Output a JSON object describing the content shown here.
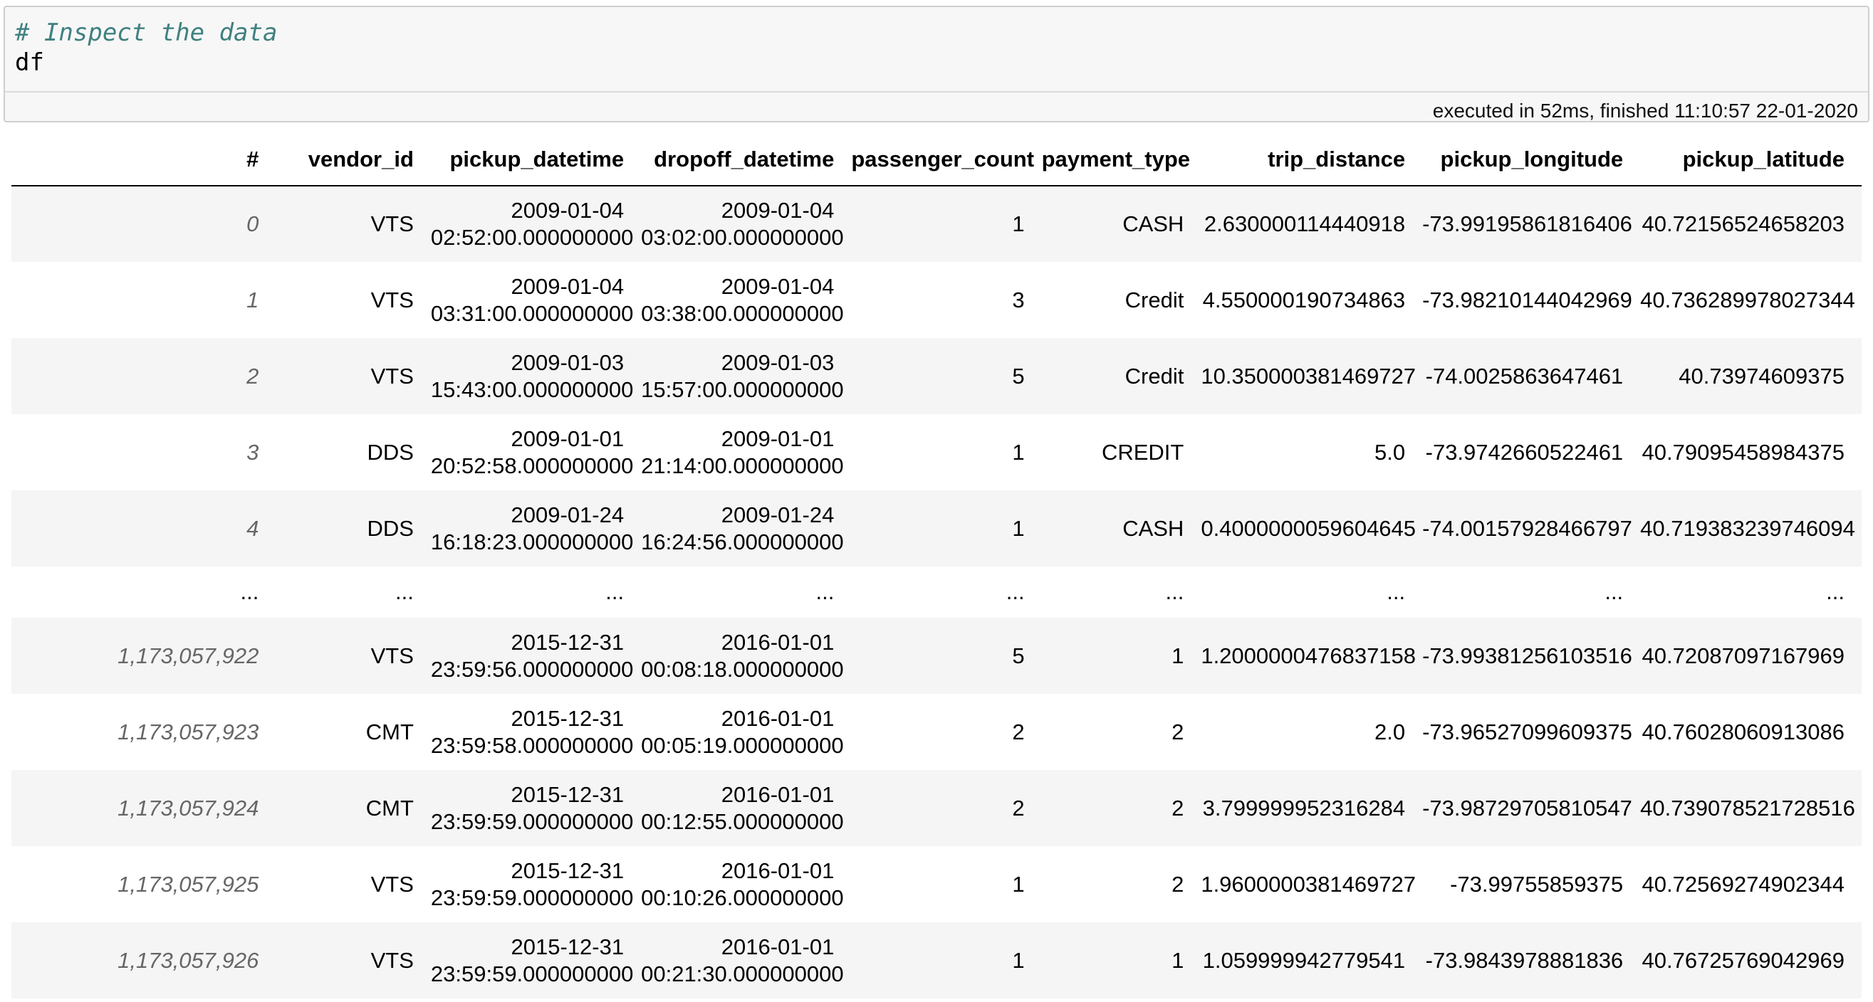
{
  "cell": {
    "comment": "# Inspect the data",
    "code": "df",
    "status": "executed in 52ms, finished 11:10:57 22-01-2020"
  },
  "table": {
    "columns": [
      "#",
      "vendor_id",
      "pickup_datetime",
      "dropoff_datetime",
      "passenger_count",
      "payment_type",
      "trip_distance",
      "pickup_longitude",
      "pickup_latitude"
    ],
    "rows_top": [
      {
        "idx": "0",
        "vendor": "VTS",
        "pickup_date": "2009-01-04",
        "pickup_time": "02:52:00.000000000",
        "dropoff_date": "2009-01-04",
        "dropoff_time": "03:02:00.000000000",
        "passengers": "1",
        "payment": "CASH",
        "distance": "2.630000114440918",
        "longitude": "-73.99195861816406",
        "latitude": "40.72156524658203"
      },
      {
        "idx": "1",
        "vendor": "VTS",
        "pickup_date": "2009-01-04",
        "pickup_time": "03:31:00.000000000",
        "dropoff_date": "2009-01-04",
        "dropoff_time": "03:38:00.000000000",
        "passengers": "3",
        "payment": "Credit",
        "distance": "4.550000190734863",
        "longitude": "-73.98210144042969",
        "latitude": "40.736289978027344"
      },
      {
        "idx": "2",
        "vendor": "VTS",
        "pickup_date": "2009-01-03",
        "pickup_time": "15:43:00.000000000",
        "dropoff_date": "2009-01-03",
        "dropoff_time": "15:57:00.000000000",
        "passengers": "5",
        "payment": "Credit",
        "distance": "10.350000381469727",
        "longitude": "-74.0025863647461",
        "latitude": "40.73974609375"
      },
      {
        "idx": "3",
        "vendor": "DDS",
        "pickup_date": "2009-01-01",
        "pickup_time": "20:52:58.000000000",
        "dropoff_date": "2009-01-01",
        "dropoff_time": "21:14:00.000000000",
        "passengers": "1",
        "payment": "CREDIT",
        "distance": "5.0",
        "longitude": "-73.9742660522461",
        "latitude": "40.79095458984375"
      },
      {
        "idx": "4",
        "vendor": "DDS",
        "pickup_date": "2009-01-24",
        "pickup_time": "16:18:23.000000000",
        "dropoff_date": "2009-01-24",
        "dropoff_time": "16:24:56.000000000",
        "passengers": "1",
        "payment": "CASH",
        "distance": "0.4000000059604645",
        "longitude": "-74.00157928466797",
        "latitude": "40.719383239746094"
      }
    ],
    "ellipsis": "...",
    "rows_bottom": [
      {
        "idx": "1,173,057,922",
        "vendor": "VTS",
        "pickup_date": "2015-12-31",
        "pickup_time": "23:59:56.000000000",
        "dropoff_date": "2016-01-01",
        "dropoff_time": "00:08:18.000000000",
        "passengers": "5",
        "payment": "1",
        "distance": "1.2000000476837158",
        "longitude": "-73.99381256103516",
        "latitude": "40.72087097167969"
      },
      {
        "idx": "1,173,057,923",
        "vendor": "CMT",
        "pickup_date": "2015-12-31",
        "pickup_time": "23:59:58.000000000",
        "dropoff_date": "2016-01-01",
        "dropoff_time": "00:05:19.000000000",
        "passengers": "2",
        "payment": "2",
        "distance": "2.0",
        "longitude": "-73.96527099609375",
        "latitude": "40.76028060913086"
      },
      {
        "idx": "1,173,057,924",
        "vendor": "CMT",
        "pickup_date": "2015-12-31",
        "pickup_time": "23:59:59.000000000",
        "dropoff_date": "2016-01-01",
        "dropoff_time": "00:12:55.000000000",
        "passengers": "2",
        "payment": "2",
        "distance": "3.799999952316284",
        "longitude": "-73.98729705810547",
        "latitude": "40.739078521728516"
      },
      {
        "idx": "1,173,057,925",
        "vendor": "VTS",
        "pickup_date": "2015-12-31",
        "pickup_time": "23:59:59.000000000",
        "dropoff_date": "2016-01-01",
        "dropoff_time": "00:10:26.000000000",
        "passengers": "1",
        "payment": "2",
        "distance": "1.9600000381469727",
        "longitude": "-73.99755859375",
        "latitude": "40.72569274902344"
      },
      {
        "idx": "1,173,057,926",
        "vendor": "VTS",
        "pickup_date": "2015-12-31",
        "pickup_time": "23:59:59.000000000",
        "dropoff_date": "2016-01-01",
        "dropoff_time": "00:21:30.000000000",
        "passengers": "1",
        "payment": "1",
        "distance": "1.059999942779541",
        "longitude": "-73.9843978881836",
        "latitude": "40.76725769042969"
      }
    ]
  }
}
